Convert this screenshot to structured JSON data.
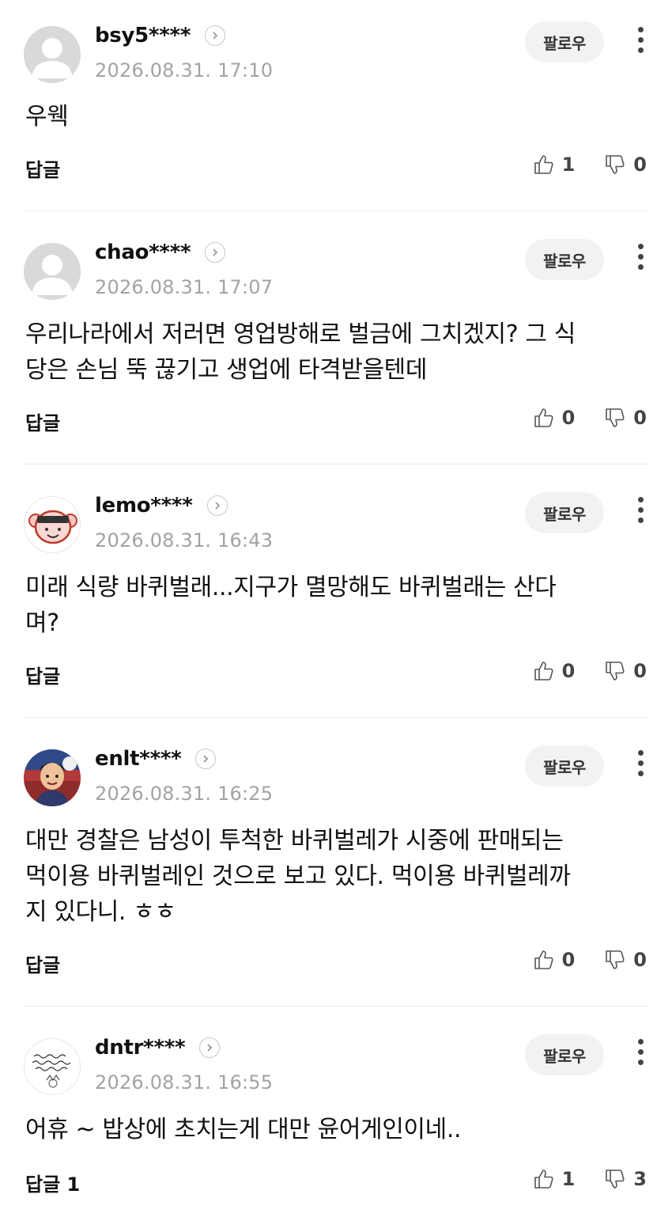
{
  "ui": {
    "follow_label": "팔로우",
    "reply_label": "답글"
  },
  "comments": [
    {
      "nickname": "bsy5****",
      "date": "2026.08.31. 17:10",
      "avatar": "default-avatar-icon",
      "lines": [
        "우웩"
      ],
      "reply": "답글",
      "likes": "1",
      "dislikes": "0"
    },
    {
      "nickname": "chao****",
      "date": "2026.08.31. 17:07",
      "avatar": "default-avatar-icon",
      "lines": [
        "우리나라에서 저러면 영업방해로 벌금에 그치겠지? 그 식",
        "당은 손님 뚝 끊기고 생업에 타격받을텐데"
      ],
      "reply": "답글",
      "likes": "0",
      "dislikes": "0"
    },
    {
      "nickname": "lemo****",
      "date": "2026.08.31. 16:43",
      "avatar": "monkey-avatar",
      "lines": [
        "미래 식량 바퀴벌래...지구가 멸망해도 바퀴벌래는 산다",
        "며?"
      ],
      "reply": "답글",
      "likes": "0",
      "dislikes": "0"
    },
    {
      "nickname": "enlt****",
      "date": "2026.08.31. 16:25",
      "avatar": "cartoon-avatar",
      "lines": [
        "대만 경찰은 남성이 투척한 바퀴벌레가 시중에 판매되는",
        "먹이용 바퀴벌레인 것으로 보고 있다. 먹이용 바퀴벌레까",
        "지 있다니. ㅎㅎ"
      ],
      "reply": "답글",
      "likes": "0",
      "dislikes": "0"
    },
    {
      "nickname": "dntr****",
      "date": "2026.08.31. 16:55",
      "avatar": "handwriting-avatar",
      "lines": [
        "어휴 ~ 밥상에 초치는게 대만 윤어게인이네.."
      ],
      "reply": "답글 1",
      "likes": "1",
      "dislikes": "3"
    }
  ]
}
